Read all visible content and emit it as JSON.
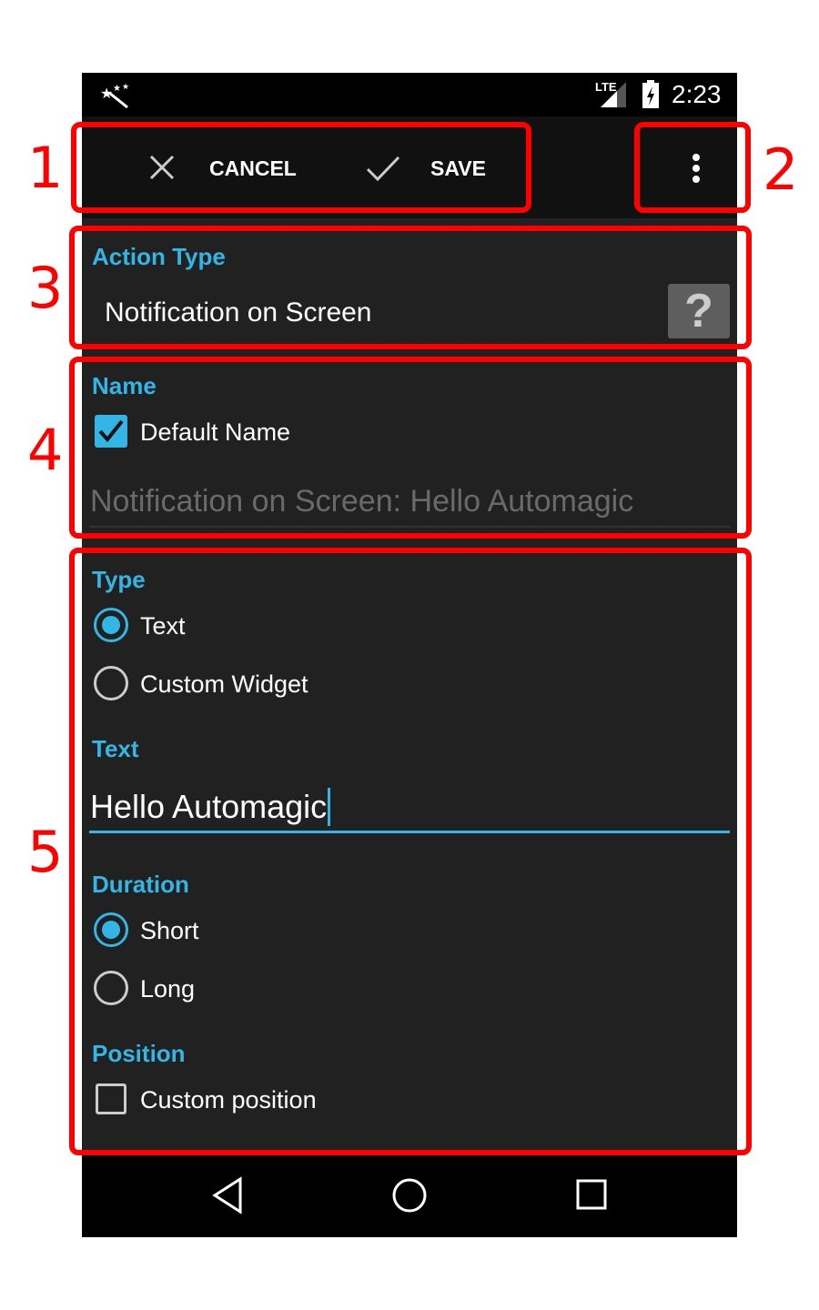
{
  "status_bar": {
    "time": "2:23",
    "network": "LTE",
    "app_icon": "magic-wand-icon"
  },
  "action_bar": {
    "cancel_label": "CANCEL",
    "save_label": "SAVE",
    "overflow_icon": "more-vert-icon"
  },
  "action_type": {
    "label": "Action Type",
    "value": "Notification on Screen",
    "help_icon": "?"
  },
  "name": {
    "label": "Name",
    "default_checkbox_label": "Default Name",
    "default_checked": true,
    "name_value": "Notification on Screen: Hello Automagic"
  },
  "type": {
    "label": "Type",
    "options": [
      "Text",
      "Custom Widget"
    ],
    "selected": "Text"
  },
  "text": {
    "label": "Text",
    "value": "Hello Automagic"
  },
  "duration": {
    "label": "Duration",
    "options": [
      "Short",
      "Long"
    ],
    "selected": "Short"
  },
  "position": {
    "label": "Position",
    "custom_label": "Custom position",
    "custom_checked": false
  },
  "annotations": [
    "1",
    "2",
    "3",
    "4",
    "5"
  ],
  "colors": {
    "accent": "#33b5e5",
    "annotation": "#ff0000",
    "background": "#212121"
  }
}
